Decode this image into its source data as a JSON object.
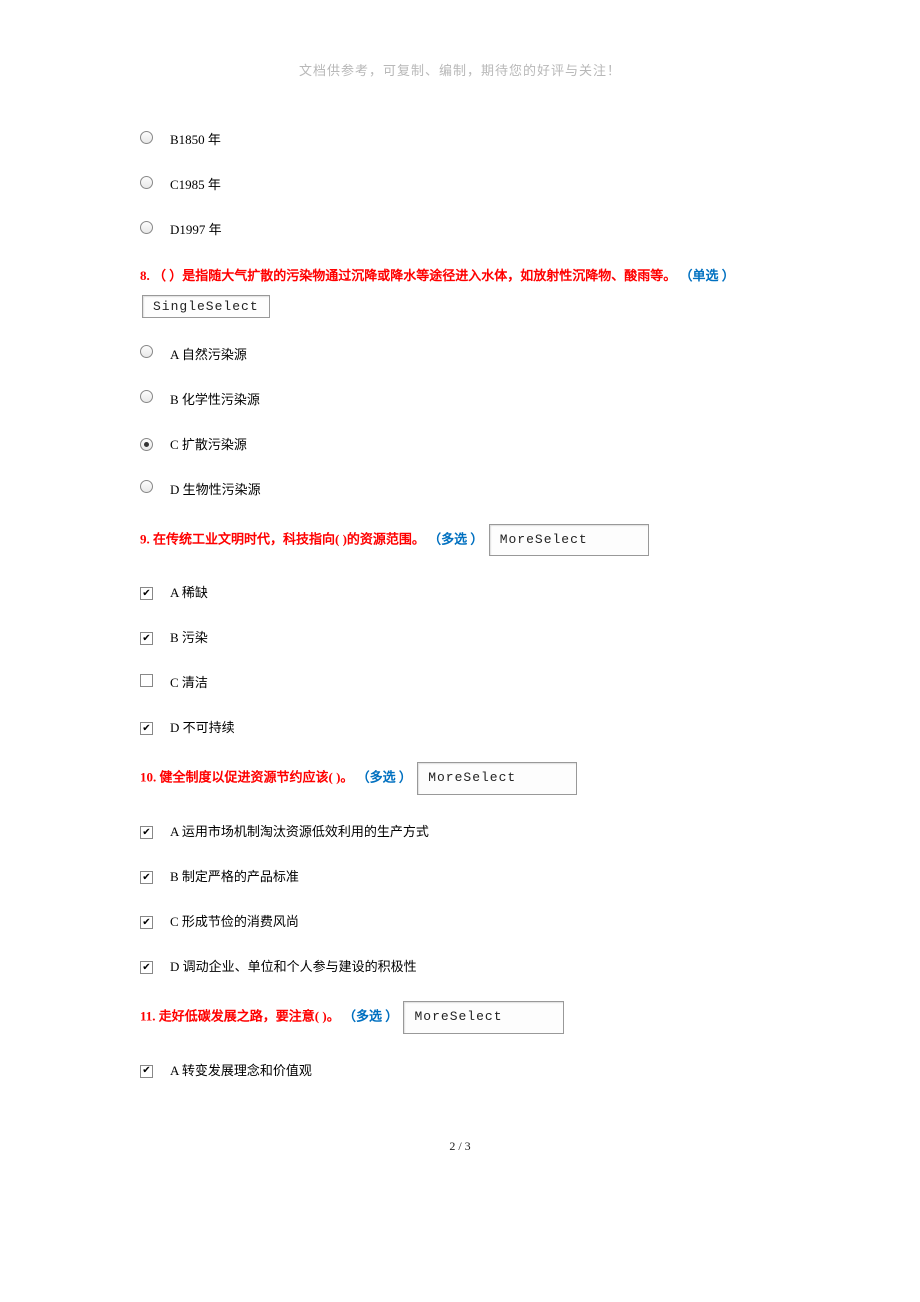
{
  "header_note": "文档供参考，可复制、编制，期待您的好评与关注！",
  "orphan_options": [
    {
      "label": "B1850 年",
      "selected": false
    },
    {
      "label": "C1985 年",
      "selected": false
    },
    {
      "label": "D1997 年",
      "selected": false
    }
  ],
  "q8": {
    "num": "8.",
    "text": "（ ）是指随大气扩散的污染物通过沉降或降水等途径进入水体，如放射性沉降物、酸雨等。",
    "type_label": "（单选 ）",
    "box": "SingleSelect",
    "options": [
      {
        "label": "A 自然污染源",
        "selected": false
      },
      {
        "label": "B 化学性污染源",
        "selected": false
      },
      {
        "label": "C 扩散污染源",
        "selected": true
      },
      {
        "label": "D 生物性污染源",
        "selected": false
      }
    ]
  },
  "q9": {
    "num": "9.",
    "text": "在传统工业文明时代，科技指向( )的资源范围。",
    "type_label": "（多选 ）",
    "box": "MoreSelect",
    "options": [
      {
        "label": "A 稀缺",
        "checked": true
      },
      {
        "label": "B 污染",
        "checked": true
      },
      {
        "label": "C 清洁",
        "checked": false
      },
      {
        "label": "D 不可持续",
        "checked": true
      }
    ]
  },
  "q10": {
    "num": "10.",
    "text": "健全制度以促进资源节约应该( )。",
    "type_label": "（多选 ）",
    "box": "MoreSelect",
    "options": [
      {
        "label": "A 运用市场机制淘汰资源低效利用的生产方式",
        "checked": true
      },
      {
        "label": "B 制定严格的产品标准",
        "checked": true
      },
      {
        "label": "C 形成节俭的消费风尚",
        "checked": true
      },
      {
        "label": "D 调动企业、单位和个人参与建设的积极性",
        "checked": true
      }
    ]
  },
  "q11": {
    "num": "11.",
    "text": "走好低碳发展之路，要注意( )。",
    "type_label": "（多选 ）",
    "box": "MoreSelect",
    "options": [
      {
        "label": "A 转变发展理念和价值观",
        "checked": true
      }
    ]
  },
  "footer": "2 / 3"
}
